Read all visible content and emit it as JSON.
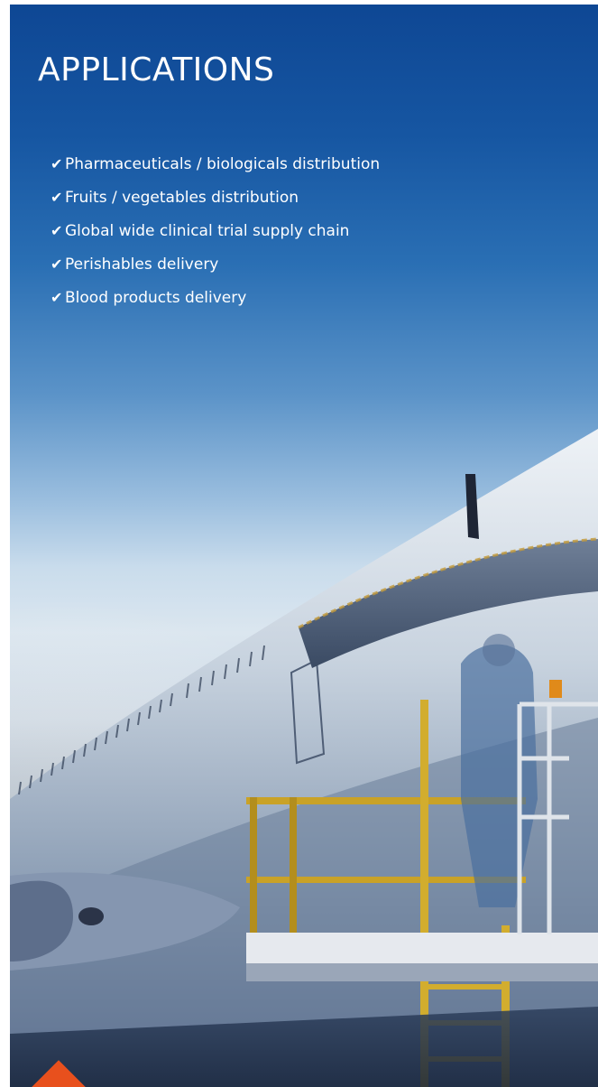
{
  "page": {
    "heading": "APPLICATIONS",
    "applications": [
      "Pharmaceuticals / biologicals distribution",
      "Fruits / vegetables distribution",
      "Global wide clinical trial supply chain",
      "Perishables delivery",
      "Blood products delivery"
    ],
    "check_icon": "checkmark-icon",
    "colors": {
      "sky_top": "#0e4794",
      "heading_text": "#ffffff",
      "accent": "#e8501d"
    }
  }
}
